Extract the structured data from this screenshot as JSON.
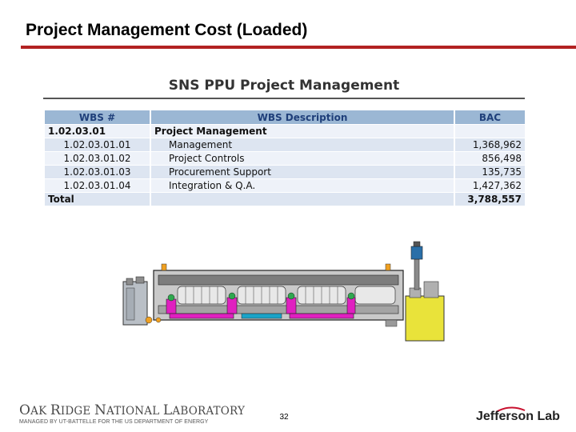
{
  "slide": {
    "title": "Project Management Cost (Loaded)",
    "page_number": "32",
    "accent_color": "#b22222"
  },
  "table": {
    "heading": "SNS PPU Project Management",
    "headers": {
      "wbs": "WBS #",
      "description": "WBS Description",
      "bac": "BAC"
    },
    "rows": [
      {
        "wbs": "1.02.03.01",
        "description": "Project Management",
        "bac": ""
      },
      {
        "wbs": "1.02.03.01.01",
        "description": "Management",
        "bac": "1,368,962"
      },
      {
        "wbs": "1.02.03.01.02",
        "description": "Project Controls",
        "bac": "856,498"
      },
      {
        "wbs": "1.02.03.01.03",
        "description": "Procurement Support",
        "bac": "135,735"
      },
      {
        "wbs": "1.02.03.01.04",
        "description": "Integration & Q.A.",
        "bac": "1,427,362"
      }
    ],
    "total": {
      "label": "Total",
      "bac": "3,788,557"
    },
    "header_color": "#9bb7d4"
  },
  "footer": {
    "ornl_name_parts": [
      "O",
      "AK ",
      "R",
      "IDGE ",
      "N",
      "ATIONAL ",
      "L",
      "ABORATORY"
    ],
    "ornl_subtitle": "MANAGED BY UT-BATTELLE FOR THE US DEPARTMENT OF ENERGY",
    "jlab_name": "Jefferson Lab"
  }
}
